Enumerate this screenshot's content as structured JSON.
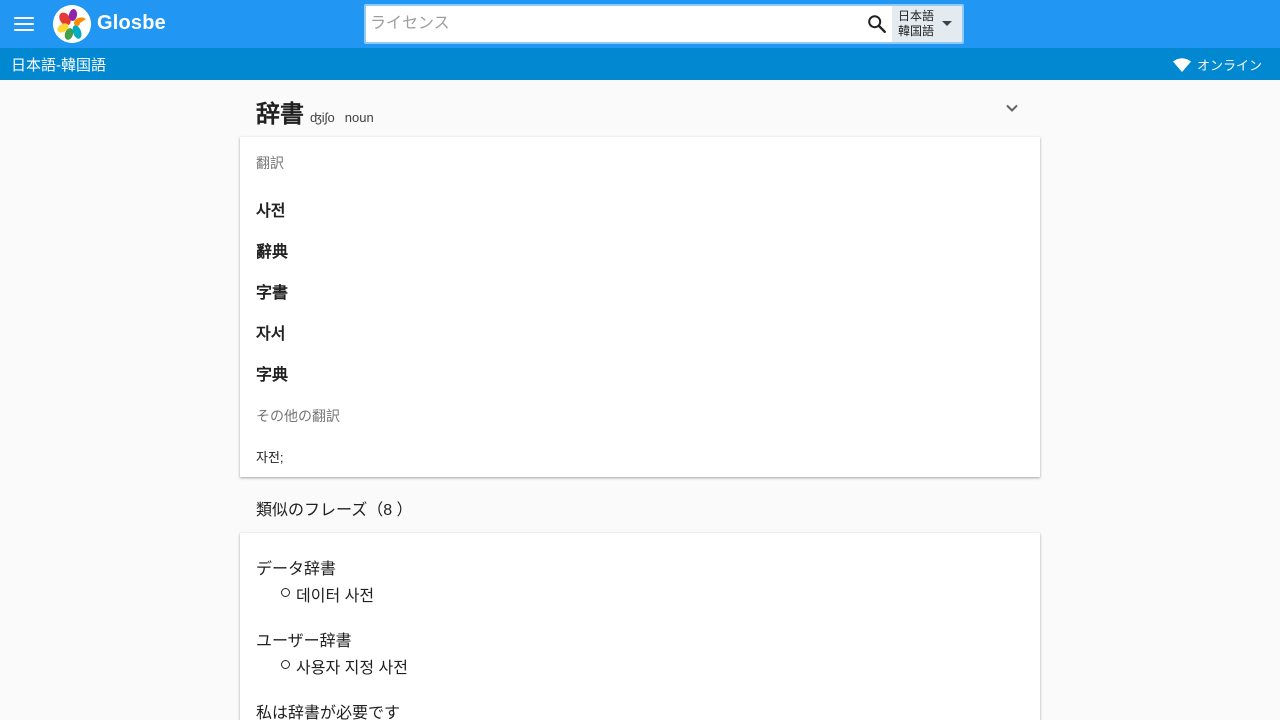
{
  "header": {
    "brand": "Glosbe",
    "search": {
      "value": "",
      "placeholder": "ライセンス"
    },
    "lang_selector": {
      "from": "日本語",
      "to": "韓国語"
    }
  },
  "subheader": {
    "pair": "日本語-韓国語",
    "status": "オンライン"
  },
  "entry": {
    "word": "辞書",
    "ipa": "ʤiʃo",
    "pos": "noun"
  },
  "translations": {
    "label": "翻訳",
    "items": [
      "사전",
      "辭典",
      "字書",
      "자서",
      "字典"
    ],
    "other_label": "その他の翻訳",
    "other_text": "자전;"
  },
  "phrases": {
    "title": "類似のフレーズ（8 ）",
    "items": [
      {
        "source": "データ辞書",
        "target": "데이터 사전"
      },
      {
        "source": "ユーザー辞書",
        "target": "사용자 지정 사전"
      },
      {
        "source": "私は辞書が必要です",
        "target": ""
      }
    ]
  },
  "colors": {
    "topbar": "#2196f3",
    "subbar": "#0288d1",
    "background": "#fafafa"
  },
  "icons": [
    "menu-icon",
    "glosbe-logo",
    "search-icon",
    "caret-down-icon",
    "wifi-icon",
    "chevron-down-icon"
  ]
}
